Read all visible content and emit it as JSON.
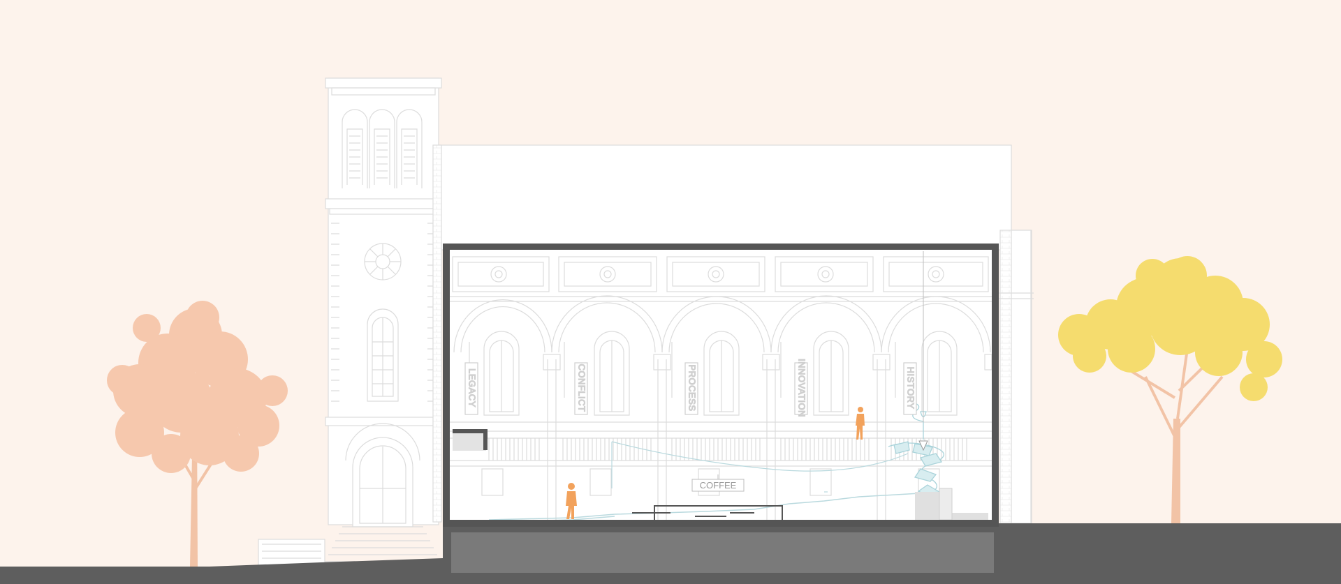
{
  "banners": [
    "LEGACY",
    "CONFLICT",
    "PROCESS",
    "INNOVATION",
    "HISTORY"
  ],
  "coffee_sign": "COFFEE",
  "colors": {
    "background": "#fdf3ec",
    "ground": "#5e5e5e",
    "section_cut": "#555555",
    "basement": "#7a7a7a",
    "linework": "#dcdcdc",
    "tree_left": "#f6c8ad",
    "tree_right": "#f5dc6e",
    "trunk": "#f2c3a6",
    "figure": "#f2a25c",
    "stair": "#bfe0e6"
  }
}
